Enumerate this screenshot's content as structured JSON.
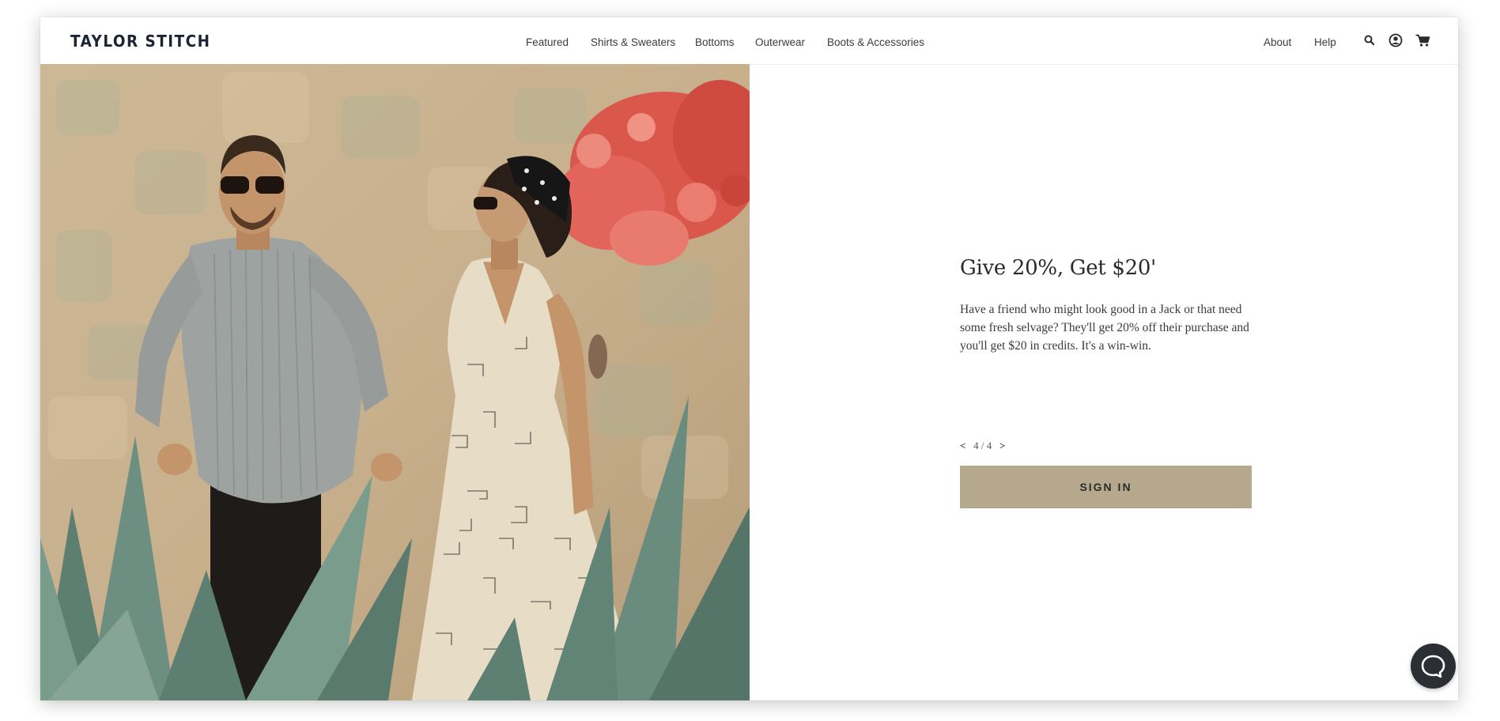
{
  "header": {
    "logo": "TAYLOR STITCH",
    "nav": [
      "Featured",
      "Shirts & Sweaters",
      "Bottoms",
      "Outerwear",
      "Boots & Accessories"
    ],
    "about": "About",
    "help": "Help",
    "icons": [
      "search-icon",
      "account-icon",
      "cart-icon"
    ]
  },
  "hero": {
    "image": "Man in striped button-down shirt and woman in patterned wrap dress standing among agave plants in front of a stone wall with red bougainvillea"
  },
  "promo": {
    "title": "Give 20%, Get $20'",
    "body": "Have a friend who might look good in a Jack or that need some fresh selvage? They'll get 20% off their purchase and you'll get $20 in credits. It's a win-win.",
    "pager": {
      "prev": "<",
      "current": "4",
      "separator": "/",
      "total": "4",
      "next": ">"
    },
    "button": "SIGN IN"
  },
  "colors": {
    "button_bg": "#b6a88d",
    "logo": "#1c2433",
    "chat_bg": "#2b2e33"
  }
}
